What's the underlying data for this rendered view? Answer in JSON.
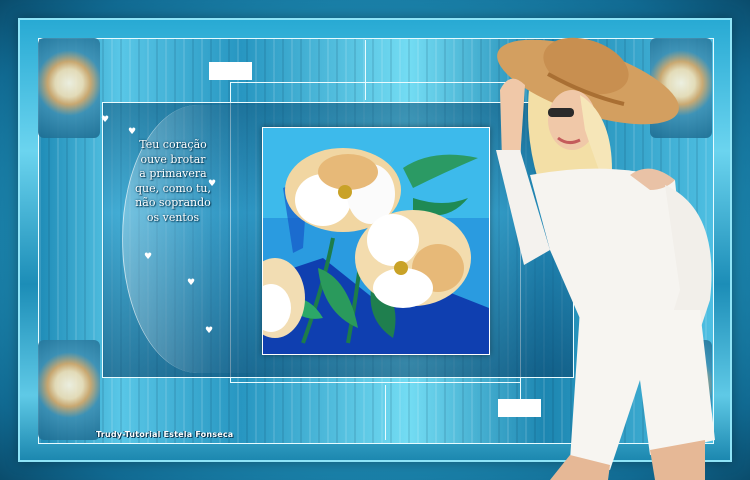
{
  "poem": {
    "lines": [
      "Teu coração",
      "ouve brotar",
      "a primavera",
      "que, como tu,",
      "não soprando",
      "os ventos"
    ]
  },
  "credit": "Trudy-Tutorial Estela Fonseca",
  "images": {
    "painting": "white and yellow flowers painting",
    "woman": "woman in white outfit and straw hat"
  },
  "colors": {
    "background": "#116a92",
    "frame_light": "#6bd4ef",
    "frame_dark": "#0a4c6c",
    "text": "#ffffff",
    "dress": "#f4f2ee",
    "hat": "#d4a46a"
  }
}
